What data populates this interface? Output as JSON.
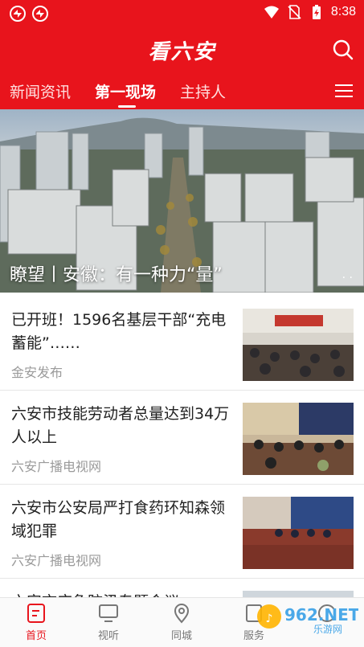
{
  "status_bar": {
    "time": "8:38"
  },
  "header": {
    "title": "看六安"
  },
  "tabs": [
    {
      "label": "新闻资讯"
    },
    {
      "label": "第一现场"
    },
    {
      "label": "主持人"
    }
  ],
  "banner": {
    "caption": "瞭望丨安徽：有一种力“量”",
    "pager": ". ."
  },
  "news": [
    {
      "title": "已开班！1596名基层干部“充电蓄能”……",
      "source": "金安发布"
    },
    {
      "title": "六安市技能劳动者总量达到34万人以上",
      "source": "六安广播电视网"
    },
    {
      "title": "六安市公安局严打食药环知森领域犯罪",
      "source": "六安广播电视网"
    },
    {
      "title": "六安市应急防汛专题会议",
      "source": ""
    }
  ],
  "bottom_nav": [
    {
      "label": "首页"
    },
    {
      "label": "视听"
    },
    {
      "label": "同城"
    },
    {
      "label": "服务"
    },
    {
      "label": ""
    }
  ],
  "watermark": {
    "text": "962.NET",
    "subtext": "乐游网"
  },
  "colors": {
    "brand_red": "#e8141c"
  }
}
